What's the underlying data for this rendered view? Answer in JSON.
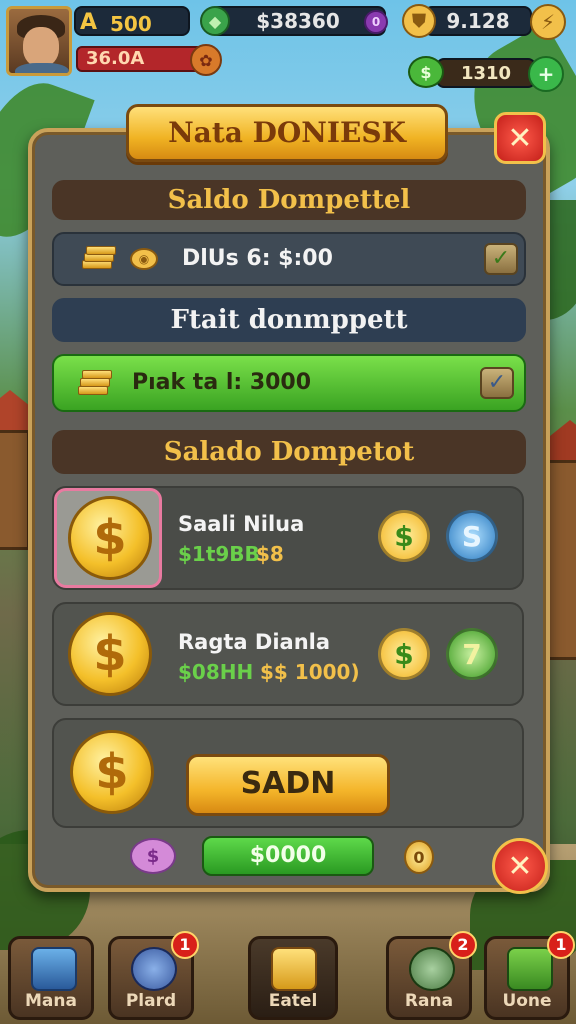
{
  "hud": {
    "level_letter": "A",
    "level_value": "500",
    "health_value": "36.0A",
    "gems_value": "$38360",
    "gold_value": "9.128",
    "cash_value": "1310"
  },
  "dialog": {
    "title": "Nata DONIESK",
    "section1_title": "Saldo Dompettel",
    "balance_row_text": "DlUs 6: $:00",
    "section2_title": "Ftait donmppett",
    "green_row_text": "Pıak ta l: 3000",
    "section3_title": "Salado Dompetot",
    "offers": [
      {
        "name": "Saali Nilua",
        "price_green": "$1t9BB",
        "price_gold": "$8",
        "coin_glyph": "$",
        "small1": "$",
        "small2": "S"
      },
      {
        "name": "Ragta Dianla",
        "price_green": "$08HH",
        "price_gold": "$$ 1000)",
        "coin_glyph": "$",
        "small1": "$",
        "small2": "7"
      }
    ],
    "third_coin_glyph": "$",
    "action_button": "SADN",
    "amount_value": "$0000",
    "amount_coin_glyph": "0",
    "close_glyph": "✕"
  },
  "nav": [
    {
      "label": "Mana",
      "badge": ""
    },
    {
      "label": "Plard",
      "badge": "1"
    },
    {
      "label": "Eatel",
      "badge": ""
    },
    {
      "label": "Rana",
      "badge": "2"
    },
    {
      "label": "Uone",
      "badge": "1"
    }
  ],
  "colors": {
    "gold": "#f2c04a",
    "panel": "#5e5f5a",
    "green": "#5ed94a",
    "red": "#d8201a"
  }
}
